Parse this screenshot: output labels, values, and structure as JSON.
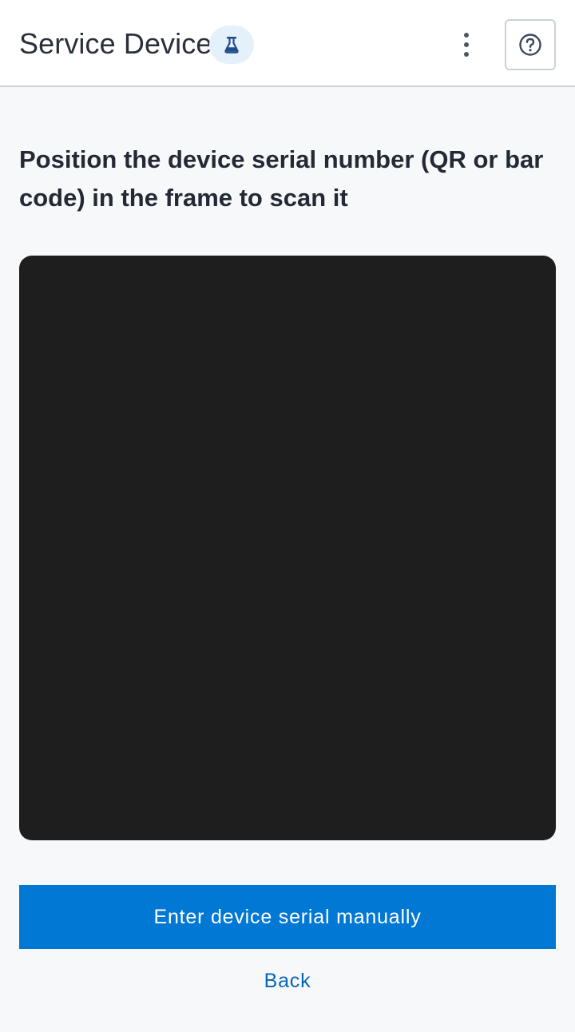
{
  "header": {
    "title": "Service Device",
    "lab_icon": "flask-icon",
    "more_icon": "more-vertical-icon",
    "help_icon": "help-circle-icon"
  },
  "main": {
    "instruction": "Position the device serial number (QR or bar code) in the frame to scan it",
    "primary_button_label": "Enter device serial manually",
    "back_label": "Back"
  },
  "colors": {
    "accent": "#0078d4",
    "link": "#0565b8",
    "camera_background": "#1e1e1e",
    "page_background": "#f7f8fa",
    "badge_background": "#e4f1fb"
  }
}
